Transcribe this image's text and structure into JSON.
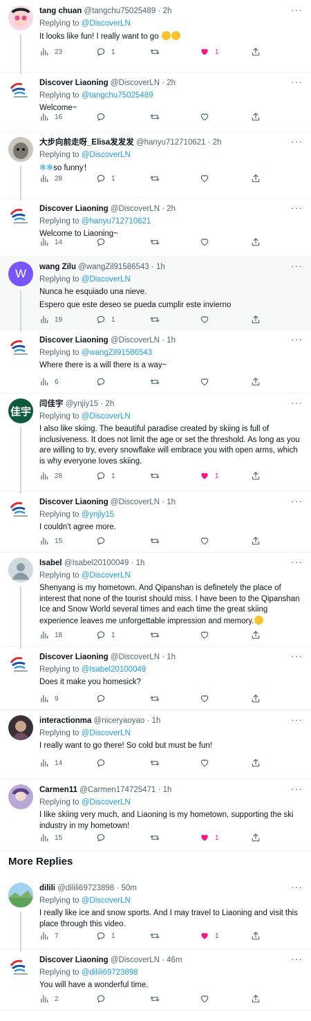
{
  "tweets": [
    {
      "name": "tang chuan",
      "handle": "@tangchu75025489",
      "time": "2h",
      "reply_prefix": "Replying to ",
      "reply_to": "@DiscoverLN",
      "text": "It looks like fun! I really want to go",
      "views": "23",
      "replies": "1",
      "retweets": "",
      "likes": "1",
      "liked": true
    },
    {
      "name": "Discover Liaoning",
      "handle": "@DiscoverLN",
      "time": "2h",
      "reply_prefix": "Replying to ",
      "reply_to": "@tangchu75025489",
      "text": "Welcome~",
      "views": "16",
      "replies": "",
      "retweets": "",
      "likes": "",
      "liked": false
    },
    {
      "name": "大步向前走呀_Elisa发发发",
      "handle": "@hanyu712710621",
      "time": "2h",
      "reply_prefix": "Replying to ",
      "reply_to": "@DiscoverLN",
      "text": "so funny！",
      "views": "28",
      "replies": "1",
      "retweets": "",
      "likes": "",
      "liked": false
    },
    {
      "name": "Discover Liaoning",
      "handle": "@DiscoverLN",
      "time": "2h",
      "reply_prefix": "Replying to ",
      "reply_to": "@hanyu712710621",
      "text": "Welcome to Liaoning~",
      "views": "14",
      "replies": "",
      "retweets": "",
      "likes": "",
      "liked": false
    },
    {
      "name": "wang Zilu",
      "handle": "@wangZil91586543",
      "time": "1h",
      "avatar_letter": "W",
      "reply_prefix": "Replying to ",
      "reply_to": "@DiscoverLN",
      "text": "Nunca he esquiado una nieve.",
      "text2": "Espero que este deseo se pueda cumplir este invierno",
      "views": "19",
      "replies": "1",
      "retweets": "",
      "likes": "",
      "liked": false
    },
    {
      "name": "Discover Liaoning",
      "handle": "@DiscoverLN",
      "time": "1h",
      "reply_prefix": "Replying to ",
      "reply_to": "@wangZil91586543",
      "text": "Where there is a will there is a way~",
      "views": "6",
      "replies": "",
      "retweets": "",
      "likes": "",
      "liked": false
    },
    {
      "name": "闫佳宇",
      "handle": "@ynjiy15",
      "time": "2h",
      "avatar_letter": "佳宇",
      "reply_prefix": "Replying to ",
      "reply_to": "@DiscoverLN",
      "text": "I also like skiing. The beautiful paradise created by skiing is full of inclusiveness. It does not limit the age or set the threshold. As long as you are willing to try, every snowflake will embrace you with open arms, which is why everyone loves skiing.",
      "views": "28",
      "replies": "1",
      "retweets": "",
      "likes": "1",
      "liked": true
    },
    {
      "name": "Discover Liaoning",
      "handle": "@DiscoverLN",
      "time": "1h",
      "reply_prefix": "Replying to ",
      "reply_to": "@ynjiy15",
      "text": "I couldn't agree more.",
      "views": "15",
      "replies": "",
      "retweets": "",
      "likes": "",
      "liked": false
    },
    {
      "name": "Isabel",
      "handle": "@Isabel20100049",
      "time": "1h",
      "reply_prefix": "Replying to ",
      "reply_to": "@DiscoverLN",
      "text": "Shenyang is my hometown. And Qipanshan is definetely the place of interest that none of the tourist should miss. I have been to the Qipanshan Ice and Snow World several times and each time the great skiing experience leaves me unforgettable impression and memory.",
      "views": "18",
      "replies": "1",
      "retweets": "",
      "likes": "",
      "liked": false
    },
    {
      "name": "Discover Liaoning",
      "handle": "@DiscoverLN",
      "time": "1h",
      "reply_prefix": "Replying to ",
      "reply_to": "@Isabel20100049",
      "text": "Does it make you homesick?",
      "views": "9",
      "replies": "",
      "retweets": "",
      "likes": "",
      "liked": false
    },
    {
      "name": "interactionma",
      "handle": "@niceryaoyao",
      "time": "1h",
      "reply_prefix": "Replying to ",
      "reply_to": "@DiscoverLN",
      "text": "I really want to go there! So cold but must be fun!",
      "views": "14",
      "replies": "",
      "retweets": "",
      "likes": "",
      "liked": false
    },
    {
      "name": "Carmen11",
      "handle": "@Carmen174725471",
      "time": "1h",
      "reply_prefix": "Replying to ",
      "reply_to": "@DiscoverLN",
      "text": "I like skiing very much, and Liaoning is my hometown, supporting the ski industry in my hometown!",
      "views": "15",
      "replies": "",
      "retweets": "",
      "likes": "1",
      "liked": true
    },
    {
      "name": "dilili",
      "handle": "@dilili69723898",
      "time": "50m",
      "reply_prefix": "Replying to ",
      "reply_to": "@DiscoverLN",
      "text": "I really like ice and snow sports. And I may travel to Liaoning and visit this place through this video.",
      "views": "7",
      "replies": "1",
      "retweets": "",
      "likes": "1",
      "liked": true
    },
    {
      "name": "Discover Liaoning",
      "handle": "@DiscoverLN",
      "time": "46m",
      "reply_prefix": "Replying to ",
      "reply_to": "@dilili69723898",
      "text": "You will have a wonderful time.",
      "views": "2",
      "replies": "",
      "retweets": "",
      "likes": "",
      "liked": false
    }
  ],
  "more_replies_title": "More Replies",
  "colors": {
    "link": "#1d9bf0",
    "like": "#f91880",
    "muted": "#536471",
    "thread": "#cfd9de",
    "highlight": "#f7f9f9"
  }
}
